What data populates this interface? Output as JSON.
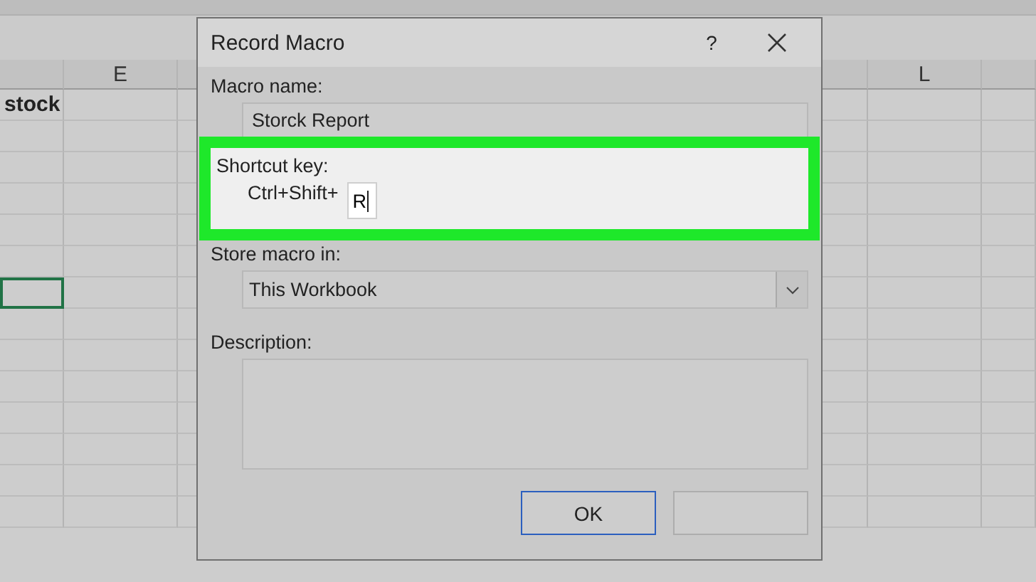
{
  "spreadsheet": {
    "column_headers": [
      "E",
      "L"
    ],
    "rows": [
      {
        "kind": "header",
        "cell": "stock",
        "selected": false
      },
      {
        "kind": "empty",
        "selected": false
      },
      {
        "kind": "empty",
        "selected": false
      },
      {
        "kind": "empty",
        "selected": false
      },
      {
        "kind": "empty",
        "selected": false
      },
      {
        "kind": "empty",
        "selected": false
      },
      {
        "kind": "empty",
        "selected": true
      },
      {
        "kind": "empty",
        "selected": false
      },
      {
        "kind": "empty",
        "selected": false
      },
      {
        "kind": "empty",
        "selected": false
      },
      {
        "kind": "empty",
        "selected": false
      },
      {
        "kind": "empty",
        "selected": false
      },
      {
        "kind": "empty",
        "selected": false
      },
      {
        "kind": "empty",
        "selected": false
      }
    ]
  },
  "dialog": {
    "title": "Record Macro",
    "help": "?",
    "macro_name": {
      "label": "Macro name:",
      "value": "Storck Report"
    },
    "shortcut_key": {
      "label": "Shortcut key:",
      "prefix": "Ctrl+Shift+",
      "value": "R",
      "highlighted": true
    },
    "store_macro_in": {
      "label": "Store macro in:",
      "value": "This Workbook"
    },
    "description": {
      "label": "Description:"
    },
    "buttons": [
      {
        "label": "OK",
        "default": true
      }
    ]
  }
}
